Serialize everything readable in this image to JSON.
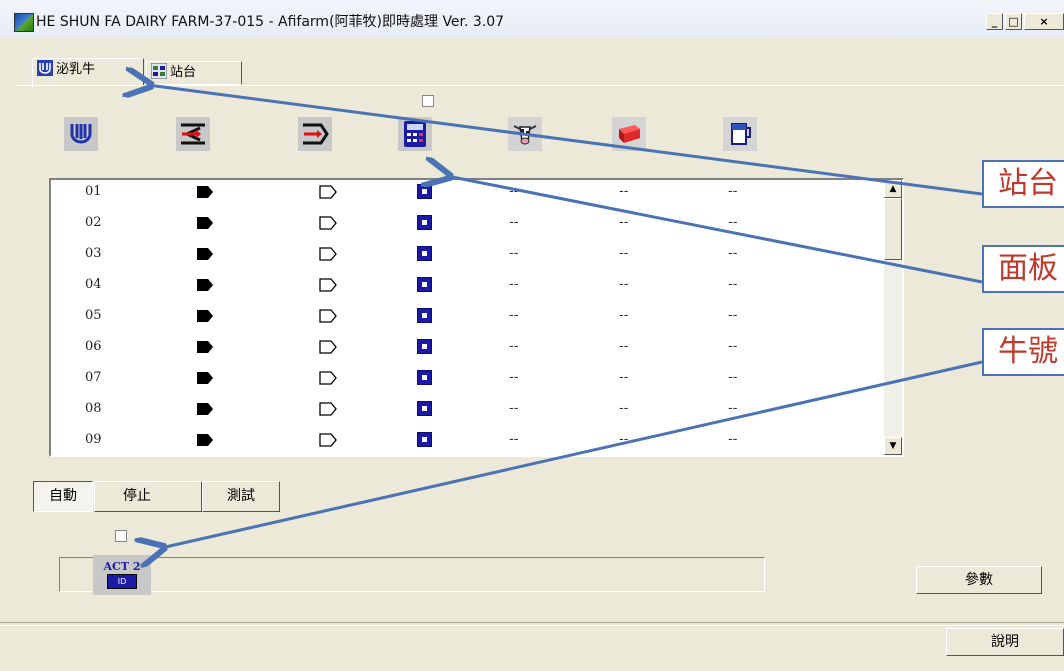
{
  "window": {
    "title": "HE SHUN FA DAIRY FARM-37-015 - Afifarm(阿菲牧)即時處理 Ver. 3.07",
    "minimize": "_",
    "maximize": "□",
    "close": "×"
  },
  "tabs": [
    {
      "label": "泌乳牛",
      "icon": "cow-udder-icon",
      "selected": true
    },
    {
      "label": "站台",
      "icon": "station-icon",
      "selected": false
    }
  ],
  "header_icons": [
    {
      "name": "milking-unit-icon"
    },
    {
      "name": "sort-in-icon"
    },
    {
      "name": "sort-out-icon"
    },
    {
      "name": "panel-calculator-icon"
    },
    {
      "name": "cow-head-icon"
    },
    {
      "name": "red-box-icon"
    },
    {
      "name": "milk-pitcher-icon"
    }
  ],
  "rows": [
    {
      "num": "01",
      "d1": "--",
      "d2": "--",
      "d3": "--"
    },
    {
      "num": "02",
      "d1": "--",
      "d2": "--",
      "d3": "--"
    },
    {
      "num": "03",
      "d1": "--",
      "d2": "--",
      "d3": "--"
    },
    {
      "num": "04",
      "d1": "--",
      "d2": "--",
      "d3": "--"
    },
    {
      "num": "05",
      "d1": "--",
      "d2": "--",
      "d3": "--"
    },
    {
      "num": "06",
      "d1": "--",
      "d2": "--",
      "d3": "--"
    },
    {
      "num": "07",
      "d1": "--",
      "d2": "--",
      "d3": "--"
    },
    {
      "num": "08",
      "d1": "--",
      "d2": "--",
      "d3": "--"
    },
    {
      "num": "09",
      "d1": "--",
      "d2": "--",
      "d3": "--"
    }
  ],
  "mode_buttons": {
    "auto": "自動",
    "stop": "停止",
    "test": "測試",
    "active": "auto"
  },
  "act_icon": {
    "top": "ACT 2",
    "badge": "ID"
  },
  "side_buttons": {
    "params": "參數",
    "help": "說明"
  },
  "callouts": [
    {
      "text": "站台"
    },
    {
      "text": "面板"
    },
    {
      "text": "牛號"
    }
  ],
  "colors": {
    "callout_border": "#4a72b4",
    "callout_text": "#c0392b",
    "arrow": "#4a72b4",
    "panel_blue": "#1a1aa6"
  }
}
